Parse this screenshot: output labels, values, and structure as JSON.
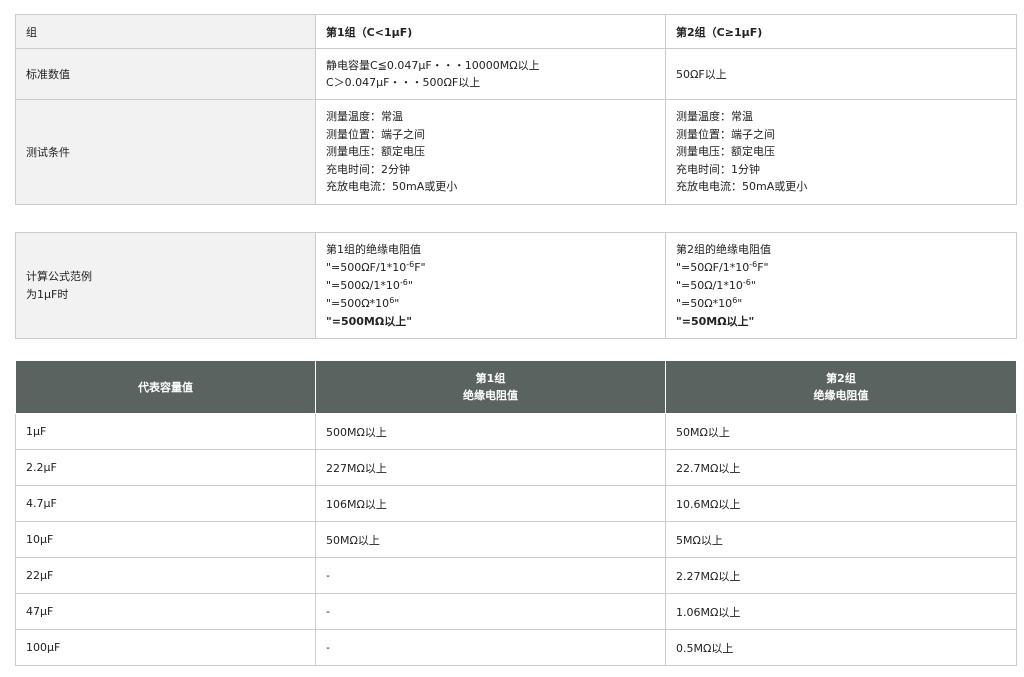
{
  "table1": {
    "header": {
      "label": "组",
      "g1": "第1组（C<1μF)",
      "g2": "第2组（C≥1μF)"
    },
    "std": {
      "label": "标准数值",
      "g1_line1": "静电容量C≦0.047μF・・・10000MΩ以上",
      "g1_line2": "C＞0.047μF・・・500ΩF以上",
      "g2": "50ΩF以上"
    },
    "cond": {
      "label": "测试条件",
      "g1": [
        "测量温度：常温",
        "测量位置：端子之间",
        "测量电压：额定电压",
        "充电时间：2分钟",
        "充放电电流：50mA或更小"
      ],
      "g2": [
        "测量温度：常温",
        "测量位置：端子之间",
        "测量电压：额定电压",
        "充电时间：1分钟",
        "充放电电流：50mA或更小"
      ]
    }
  },
  "table2": {
    "label_line1": "计算公式范例",
    "label_line2": "为1μF时",
    "g1": {
      "title": "第1组的绝缘电阻值",
      "l1a": "\"=500ΩF/1*10",
      "l1exp": "-6",
      "l1b": "F\"",
      "l2a": "\"=500Ω/1*10",
      "l2exp": "-6",
      "l2b": "\"",
      "l3a": "\"=500Ω*10",
      "l3exp": "6",
      "l3b": "\"",
      "result": "\"=500MΩ以上\""
    },
    "g2": {
      "title": "第2组的绝缘电阻值",
      "l1a": "\"=50ΩF/1*10",
      "l1exp": "-6",
      "l1b": "F\"",
      "l2a": "\"=50Ω/1*10",
      "l2exp": "-6",
      "l2b": "\"",
      "l3a": "\"=50Ω*10",
      "l3exp": "6",
      "l3b": "\"",
      "result": "\"=50MΩ以上\""
    }
  },
  "table3": {
    "header": {
      "col1": "代表容量值",
      "col2_line1": "第1组",
      "col2_line2": "绝缘电阻值",
      "col3_line1": "第2组",
      "col3_line2": "绝缘电阻值"
    },
    "rows": [
      {
        "cap": "1μF",
        "g1": "500MΩ以上",
        "g2": "50MΩ以上"
      },
      {
        "cap": "2.2μF",
        "g1": "227MΩ以上",
        "g2": "22.7MΩ以上"
      },
      {
        "cap": "4.7μF",
        "g1": "106MΩ以上",
        "g2": "10.6MΩ以上"
      },
      {
        "cap": "10μF",
        "g1": "50MΩ以上",
        "g2": "5MΩ以上"
      },
      {
        "cap": "22μF",
        "g1": "-",
        "g2": "2.27MΩ以上"
      },
      {
        "cap": "47μF",
        "g1": "-",
        "g2": "1.06MΩ以上"
      },
      {
        "cap": "100μF",
        "g1": "-",
        "g2": "0.5MΩ以上"
      }
    ]
  }
}
